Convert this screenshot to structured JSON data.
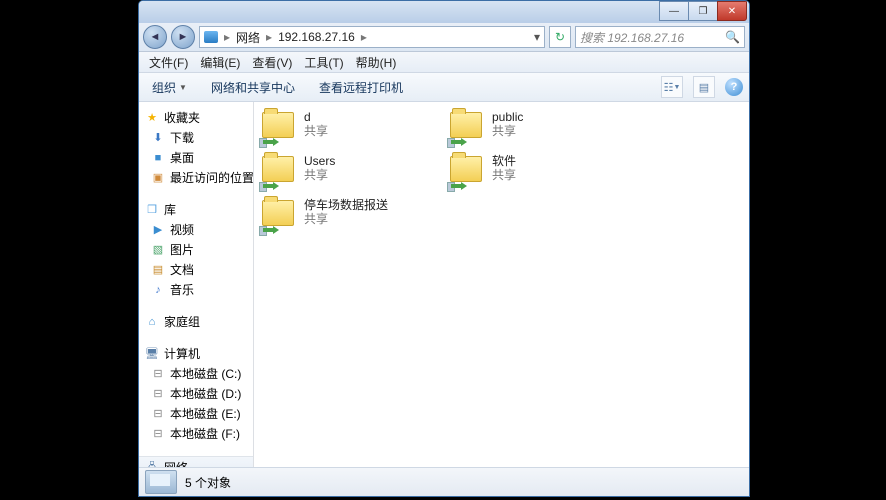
{
  "titlebar": {},
  "winbtns": {
    "min": "—",
    "max": "❐",
    "close": "✕"
  },
  "address": {
    "breadcrumb": [
      "网络",
      "192.168.27.16"
    ],
    "search_placeholder": "搜索 192.168.27.16"
  },
  "menubar": [
    "文件(F)",
    "编辑(E)",
    "查看(V)",
    "工具(T)",
    "帮助(H)"
  ],
  "toolbar": {
    "organize": "组织",
    "network_center": "网络和共享中心",
    "remote_printers": "查看远程打印机"
  },
  "nav": {
    "favorites": {
      "label": "收藏夹",
      "items": [
        "下载",
        "桌面",
        "最近访问的位置"
      ]
    },
    "libraries": {
      "label": "库",
      "items": [
        "视频",
        "图片",
        "文档",
        "音乐"
      ]
    },
    "homegroup": {
      "label": "家庭组"
    },
    "computer": {
      "label": "计算机",
      "items": [
        "本地磁盘 (C:)",
        "本地磁盘 (D:)",
        "本地磁盘 (E:)",
        "本地磁盘 (F:)"
      ]
    },
    "network": {
      "label": "网络"
    }
  },
  "items": [
    {
      "name": "d",
      "sub": "共享"
    },
    {
      "name": "public",
      "sub": "共享"
    },
    {
      "name": "Users",
      "sub": "共享"
    },
    {
      "name": "软件",
      "sub": "共享"
    },
    {
      "name": "停车场数据报送",
      "sub": "共享"
    }
  ],
  "status": {
    "count": "5 个对象"
  }
}
